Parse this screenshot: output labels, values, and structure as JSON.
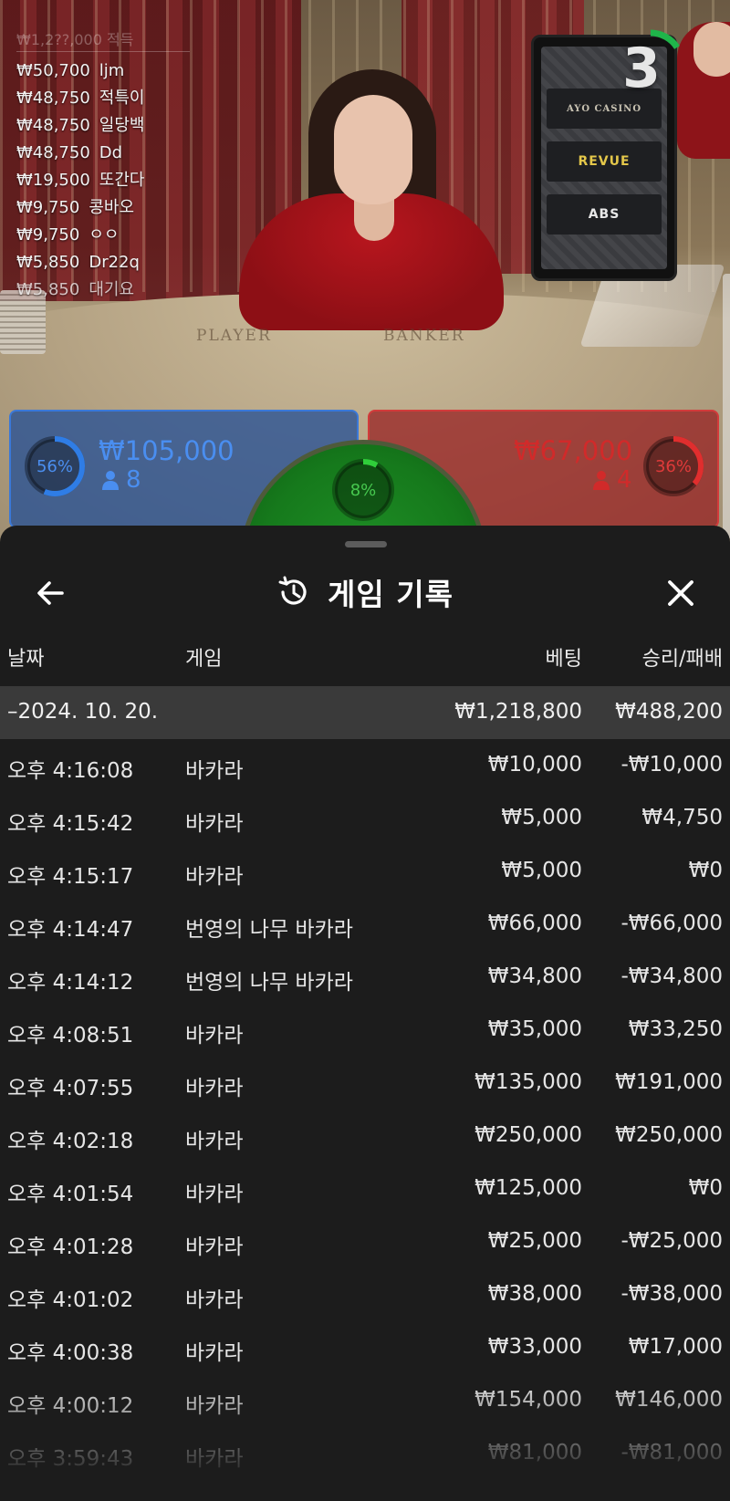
{
  "video": {
    "feed_top": "₩1,2??,000 적득",
    "bets": [
      {
        "amount": "₩50,700",
        "name": "ljm"
      },
      {
        "amount": "₩48,750",
        "name": "적특이"
      },
      {
        "amount": "₩48,750",
        "name": "일당백"
      },
      {
        "amount": "₩48,750",
        "name": "Dd"
      },
      {
        "amount": "₩19,500",
        "name": "또간다"
      },
      {
        "amount": "₩9,750",
        "name": "콩바오"
      },
      {
        "amount": "₩9,750",
        "name": "ㅇㅇ"
      },
      {
        "amount": "₩5,850",
        "name": "Dr22q"
      },
      {
        "amount": "₩5,850",
        "name": "대기요"
      }
    ],
    "felt_player": "PLAYER",
    "felt_banker": "BANKER",
    "countdown": "3",
    "sponsors": [
      "AYO CASINO",
      "REVUE",
      "ABS"
    ]
  },
  "bet_summary": {
    "player": {
      "percent": "56%",
      "percent_value": 56,
      "amount": "₩105,000",
      "count": "8",
      "color": "#4a8ef0"
    },
    "tie": {
      "percent": "8%",
      "percent_value": 8,
      "color": "#47c94f"
    },
    "banker": {
      "percent": "36%",
      "percent_value": 36,
      "amount": "₩67,000",
      "count": "4",
      "color": "#d12a2a"
    }
  },
  "history": {
    "title": "게임 기록",
    "icons": {
      "back": "arrow-left-icon",
      "history": "history-icon",
      "close": "close-icon"
    },
    "columns": {
      "date": "날짜",
      "game": "게임",
      "bet": "베팅",
      "win": "승리/패배"
    },
    "group": {
      "date": "–2024. 10. 20.",
      "bet": "₩1,218,800",
      "win": "₩488,200"
    },
    "rows": [
      {
        "time": "오후 4:16:08",
        "game": "바카라",
        "bet": "₩10,000",
        "win": "-₩10,000"
      },
      {
        "time": "오후 4:15:42",
        "game": "바카라",
        "bet": "₩5,000",
        "win": "₩4,750"
      },
      {
        "time": "오후 4:15:17",
        "game": "바카라",
        "bet": "₩5,000",
        "win": "₩0"
      },
      {
        "time": "오후 4:14:47",
        "game": "번영의 나무 바카라",
        "bet": "₩66,000",
        "win": "-₩66,000"
      },
      {
        "time": "오후 4:14:12",
        "game": "번영의 나무 바카라",
        "bet": "₩34,800",
        "win": "-₩34,800"
      },
      {
        "time": "오후 4:08:51",
        "game": "바카라",
        "bet": "₩35,000",
        "win": "₩33,250"
      },
      {
        "time": "오후 4:07:55",
        "game": "바카라",
        "bet": "₩135,000",
        "win": "₩191,000"
      },
      {
        "time": "오후 4:02:18",
        "game": "바카라",
        "bet": "₩250,000",
        "win": "₩250,000"
      },
      {
        "time": "오후 4:01:54",
        "game": "바카라",
        "bet": "₩125,000",
        "win": "₩0"
      },
      {
        "time": "오후 4:01:28",
        "game": "바카라",
        "bet": "₩25,000",
        "win": "-₩25,000"
      },
      {
        "time": "오후 4:01:02",
        "game": "바카라",
        "bet": "₩38,000",
        "win": "-₩38,000"
      },
      {
        "time": "오후 4:00:38",
        "game": "바카라",
        "bet": "₩33,000",
        "win": "₩17,000"
      },
      {
        "time": "오후 4:00:12",
        "game": "바카라",
        "bet": "₩154,000",
        "win": "₩146,000"
      },
      {
        "time": "오후 3:59:43",
        "game": "바카라",
        "bet": "₩81,000",
        "win": "-₩81,000"
      }
    ]
  }
}
